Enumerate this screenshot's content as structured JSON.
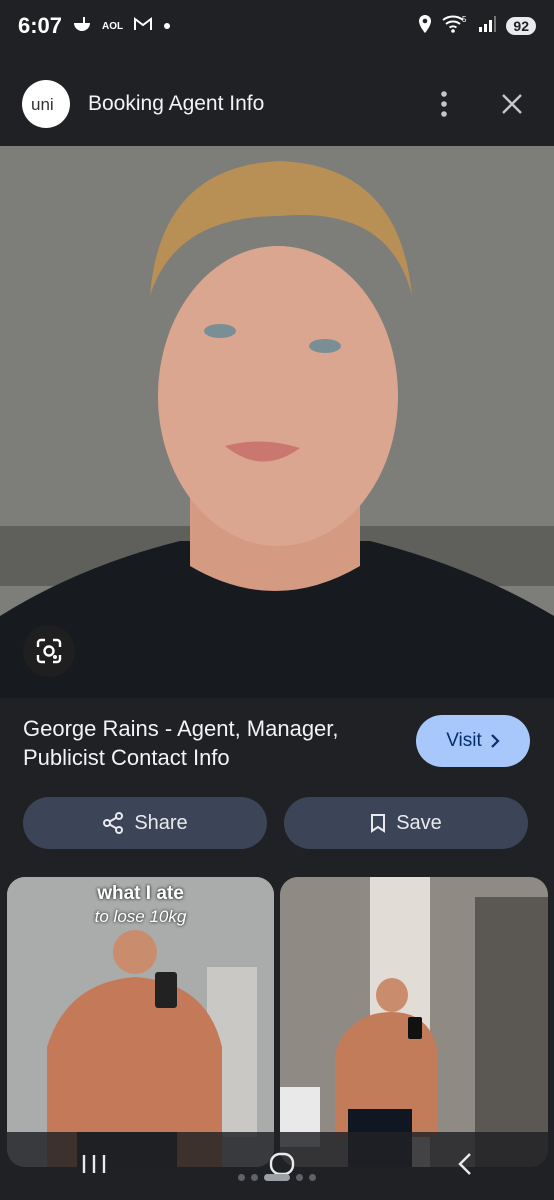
{
  "status": {
    "time": "6:07",
    "aol": "AOL",
    "battery": "92",
    "signal_superscript": "5"
  },
  "header": {
    "title": "Booking Agent Info",
    "logo_text": "uni",
    "menu_icon": "more-vert-icon",
    "close_icon": "close-icon"
  },
  "result": {
    "title": "George Rains - Agent, Manager, Publicist Contact Info",
    "visit_label": "Visit"
  },
  "actions": {
    "share_label": "Share",
    "save_label": "Save"
  },
  "thumbnails": [
    {
      "overlay_line1": "what I ate",
      "overlay_line2": "to lose 10kg"
    },
    {
      "overlay_line1": "",
      "overlay_line2": ""
    }
  ],
  "colors": {
    "background": "#202124",
    "visit_button": "#a8c7fa",
    "pill_button": "#3c4458"
  }
}
